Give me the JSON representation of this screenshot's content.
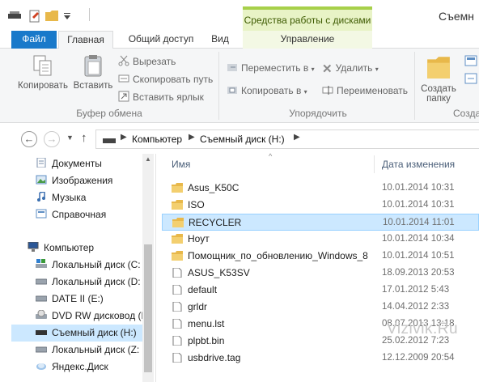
{
  "titlebar": {
    "window_title": "Съемн",
    "context_tab_header": "Средства работы с дисками"
  },
  "tabs": [
    {
      "label": "Файл"
    },
    {
      "label": "Главная"
    },
    {
      "label": "Общий доступ"
    },
    {
      "label": "Вид"
    },
    {
      "label": "Управление"
    }
  ],
  "ribbon": {
    "clipboard": {
      "copy": "Копировать",
      "paste": "Вставить",
      "cut": "Вырезать",
      "copy_path": "Скопировать путь",
      "paste_shortcut": "Вставить ярлык",
      "group_label": "Буфер обмена"
    },
    "organize": {
      "move_to": "Переместить в",
      "copy_to": "Копировать в",
      "delete": "Удалить",
      "rename": "Переименовать",
      "group_label": "Упорядочить"
    },
    "create": {
      "new_folder_line1": "Создать",
      "new_folder_line2": "папку",
      "group_label": "Создать"
    }
  },
  "address": {
    "crumbs": [
      "Компьютер",
      "Съемный диск (H:)"
    ]
  },
  "navpane": {
    "items": [
      {
        "label": "Документы",
        "icon": "documents-icon"
      },
      {
        "label": "Изображения",
        "icon": "pictures-icon"
      },
      {
        "label": "Музыка",
        "icon": "music-icon"
      },
      {
        "label": "Справочная",
        "icon": "reference-icon"
      },
      {
        "label": "Компьютер",
        "icon": "computer-icon"
      },
      {
        "label": "Локальный диск (C:",
        "icon": "system-drive-icon"
      },
      {
        "label": "Локальный диск (D:",
        "icon": "drive-icon"
      },
      {
        "label": "DATE II (E:)",
        "icon": "drive-icon"
      },
      {
        "label": "DVD RW дисковод (F",
        "icon": "dvd-drive-icon"
      },
      {
        "label": "Съемный диск (H:)",
        "icon": "usb-drive-icon",
        "selected": true
      },
      {
        "label": "Локальный диск (Z:",
        "icon": "drive-icon"
      },
      {
        "label": "Яндекс.Диск",
        "icon": "yandex-disk-icon"
      }
    ]
  },
  "filelist": {
    "columns": {
      "name": "Имя",
      "date": "Дата изменения"
    },
    "rows": [
      {
        "name": "Asus_K50C",
        "date": "10.01.2014 10:31",
        "type": "folder"
      },
      {
        "name": "ISO",
        "date": "10.01.2014 10:31",
        "type": "folder"
      },
      {
        "name": "RECYCLER",
        "date": "10.01.2014 11:01",
        "type": "folder",
        "selected": true
      },
      {
        "name": "Ноут",
        "date": "10.01.2014 10:34",
        "type": "folder"
      },
      {
        "name": "Помощник_по_обновлению_Windows_8",
        "date": "10.01.2014 10:51",
        "type": "folder"
      },
      {
        "name": "ASUS_K53SV",
        "date": "18.09.2013 20:53",
        "type": "file"
      },
      {
        "name": "default",
        "date": "17.01.2012 5:43",
        "type": "file"
      },
      {
        "name": "grldr",
        "date": "14.04.2012 2:33",
        "type": "file"
      },
      {
        "name": "menu.lst",
        "date": "08.07.2013 13:18",
        "type": "file"
      },
      {
        "name": "plpbt.bin",
        "date": "25.02.2012 7:23",
        "type": "file"
      },
      {
        "name": "usbdrive.tag",
        "date": "12.12.2009 20:54",
        "type": "file"
      }
    ]
  },
  "watermark": "Vizivik.Ru",
  "colors": {
    "file_tab": "#1979ca",
    "context_tab": "#e8f3c6",
    "context_accent": "#a7d04a",
    "selection": "#cce8ff",
    "folder": "#e8b84a"
  }
}
